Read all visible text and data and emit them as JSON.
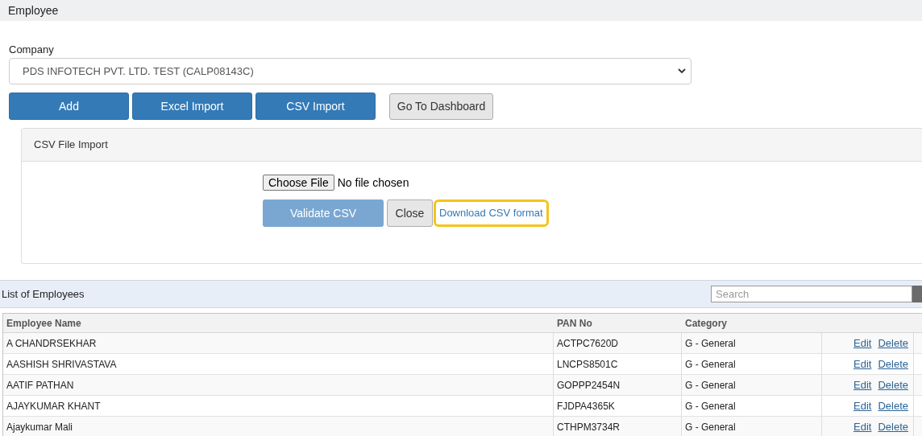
{
  "page_title": "Employee",
  "company": {
    "label": "Company",
    "value": "PDS INFOTECH PVT. LTD. TEST (CALP08143C)"
  },
  "buttons": [
    {
      "label": "Add",
      "kind": "primary"
    },
    {
      "label": "Excel Import",
      "kind": "primary"
    },
    {
      "label": "CSV Import",
      "kind": "primary"
    },
    {
      "label": "Go To Dashboard",
      "kind": "secondary"
    }
  ],
  "import_panel": {
    "title": "CSV File Import",
    "file_button": "Choose File",
    "file_status": "No file chosen",
    "validate_button": {
      "label": "Validate CSV",
      "disabled": true
    },
    "close_button": "Close",
    "download_link": {
      "label": "Download CSV format",
      "highlighted": true
    }
  },
  "list": {
    "title": "List of Employees",
    "search": {
      "placeholder": "Search"
    },
    "columns": [
      "Employee Name",
      "PAN No",
      "Category"
    ],
    "rows": [
      {
        "name": "A CHANDRSEKHAR",
        "pan": "ACTPC7620D",
        "category": "G - General",
        "actions": [
          "Edit",
          "Delete"
        ]
      },
      {
        "name": "AASHISH SHRIVASTAVA",
        "pan": "LNCPS8501C",
        "category": "G - General",
        "actions": [
          "Edit",
          "Delete"
        ]
      },
      {
        "name": "AATIF PATHAN",
        "pan": "GOPPP2454N",
        "category": "G - General",
        "actions": [
          "Edit",
          "Delete"
        ]
      },
      {
        "name": "AJAYKUMAR KHANT",
        "pan": "FJDPA4365K",
        "category": "G - General",
        "actions": [
          "Edit",
          "Delete"
        ]
      },
      {
        "name": "Ajaykumar Mali",
        "pan": "CTHPM3734R",
        "category": "G - General",
        "actions": [
          "Edit",
          "Delete"
        ]
      }
    ]
  }
}
